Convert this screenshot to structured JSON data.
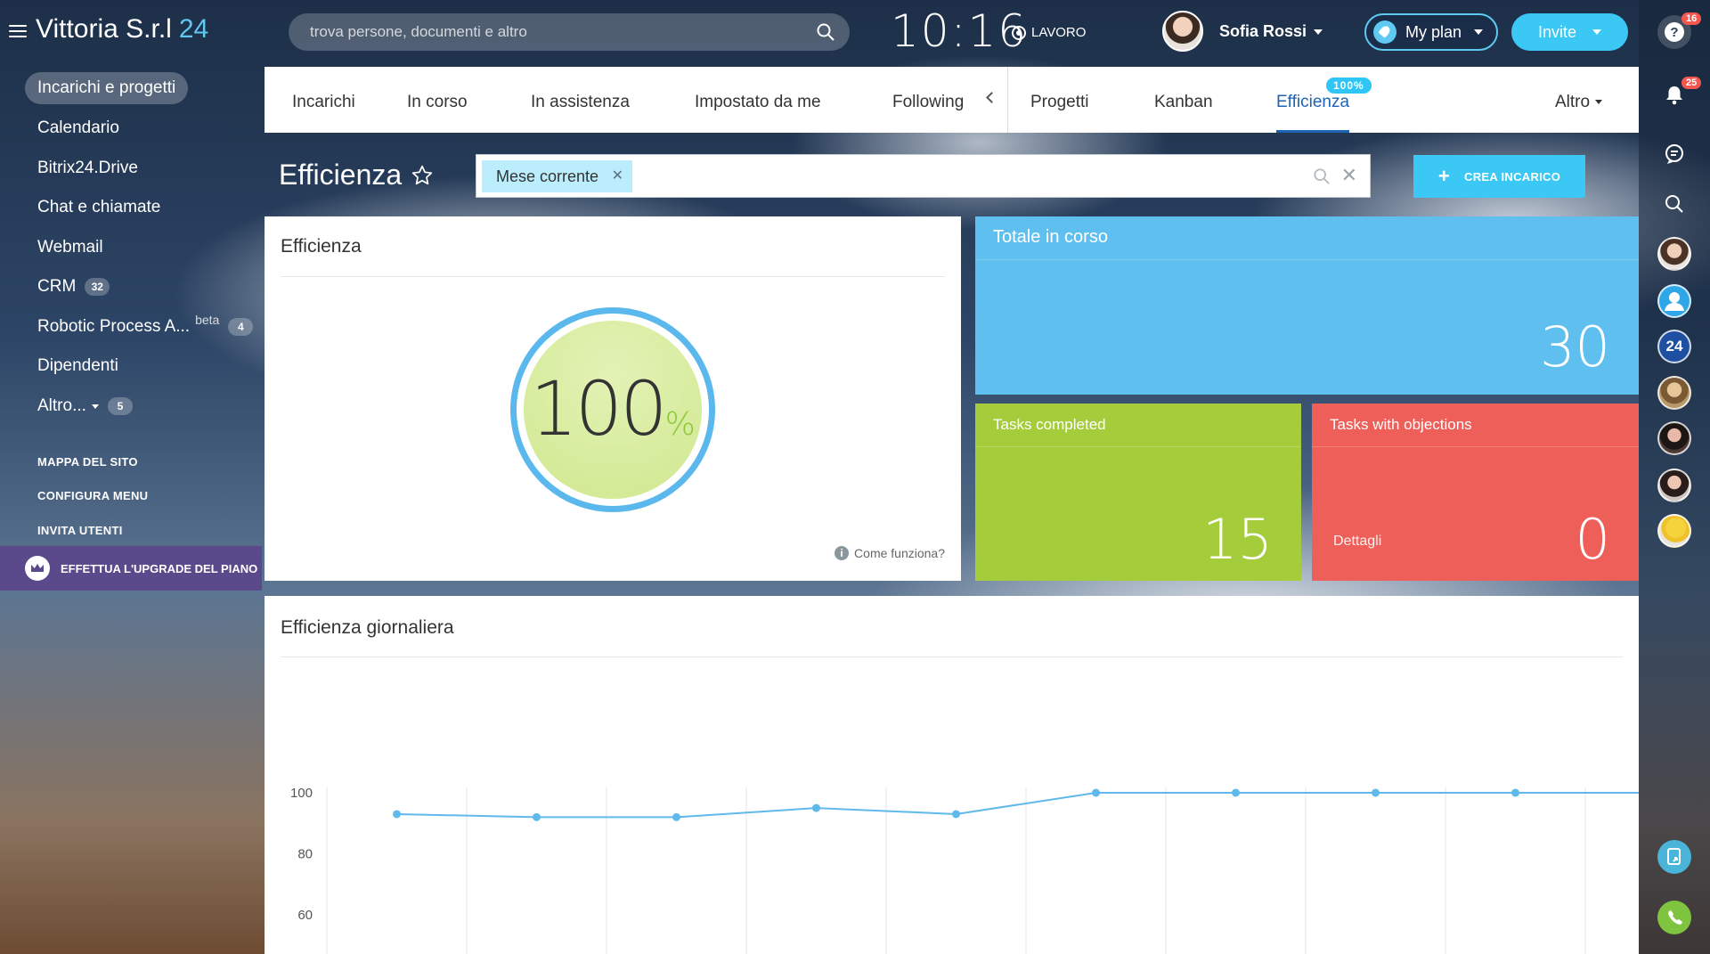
{
  "app": {
    "brand_name": "Vittoria S.r.l",
    "brand_number": "24"
  },
  "header": {
    "search_placeholder": "trova persone, documenti e altro",
    "clock": "10:16",
    "work_status": "LAVORO",
    "user_name": "Sofia Rossi",
    "myplan_label": "My plan",
    "invite_label": "Invite"
  },
  "sidebar": {
    "items": [
      {
        "label": "Incarichi e progetti"
      },
      {
        "label": "Calendario"
      },
      {
        "label": "Bitrix24.Drive"
      },
      {
        "label": "Chat e chiamate"
      },
      {
        "label": "Webmail"
      },
      {
        "label": "CRM",
        "counter": "32"
      },
      {
        "label": "Robotic Process A...",
        "sup": "beta",
        "counter": "4"
      },
      {
        "label": "Dipendenti"
      },
      {
        "label": "Altro...",
        "counter": "5"
      }
    ],
    "links": [
      "MAPPA DEL SITO",
      "CONFIGURA MENU",
      "INVITA UTENTI"
    ],
    "upgrade_label": "EFFETTUA L'UPGRADE DEL PIANO"
  },
  "tabs": {
    "items": [
      "Incarichi",
      "In corso",
      "In assistenza",
      "Impostato da me",
      "Following",
      "Progetti",
      "Kanban",
      "Efficienza"
    ],
    "active_badge": "100%",
    "more_label": "Altro"
  },
  "page": {
    "title": "Efficienza",
    "filter_chip": "Mese corrente",
    "create_button": "CREA INCARICO"
  },
  "efficiency": {
    "card_title": "Efficienza",
    "value": "100",
    "unit": "%",
    "fill_fraction": 1.0,
    "how_label": "Come funziona?"
  },
  "stats": {
    "total": {
      "label": "Totale in corso",
      "value": "30"
    },
    "completed": {
      "label": "Tasks completed",
      "value": "15"
    },
    "objections": {
      "label": "Tasks with objections",
      "value": "0",
      "details_label": "Dettagli"
    }
  },
  "daily": {
    "title": "Efficienza giornaliera"
  },
  "colors": {
    "accent": "#3bc8f5",
    "active_tab": "#1f64b4",
    "total_tile": "#5fc0f0",
    "completed_tile": "#a5cc3b",
    "objections_tile": "#ef5f59",
    "upgrade": "#5a4a8c"
  },
  "right_rail": {
    "help_badge": "16",
    "notifications_badge": "25",
    "bitrix_label": "24",
    "icons": [
      "help-icon",
      "bell-icon",
      "chat-icon",
      "search-icon",
      "contacts-icon",
      "phone-icon"
    ]
  },
  "chart_data": {
    "type": "line",
    "title": "",
    "xlabel": "",
    "ylabel": "",
    "ylim": [
      55,
      100
    ],
    "yticks": [
      100,
      80,
      60
    ],
    "grid": true,
    "x": [
      1,
      2,
      3,
      4,
      5,
      6,
      7,
      8,
      9,
      10
    ],
    "series": [
      {
        "values": [
          93,
          92,
          92,
          95,
          93,
          100,
          100,
          100,
          100,
          100
        ]
      }
    ]
  }
}
